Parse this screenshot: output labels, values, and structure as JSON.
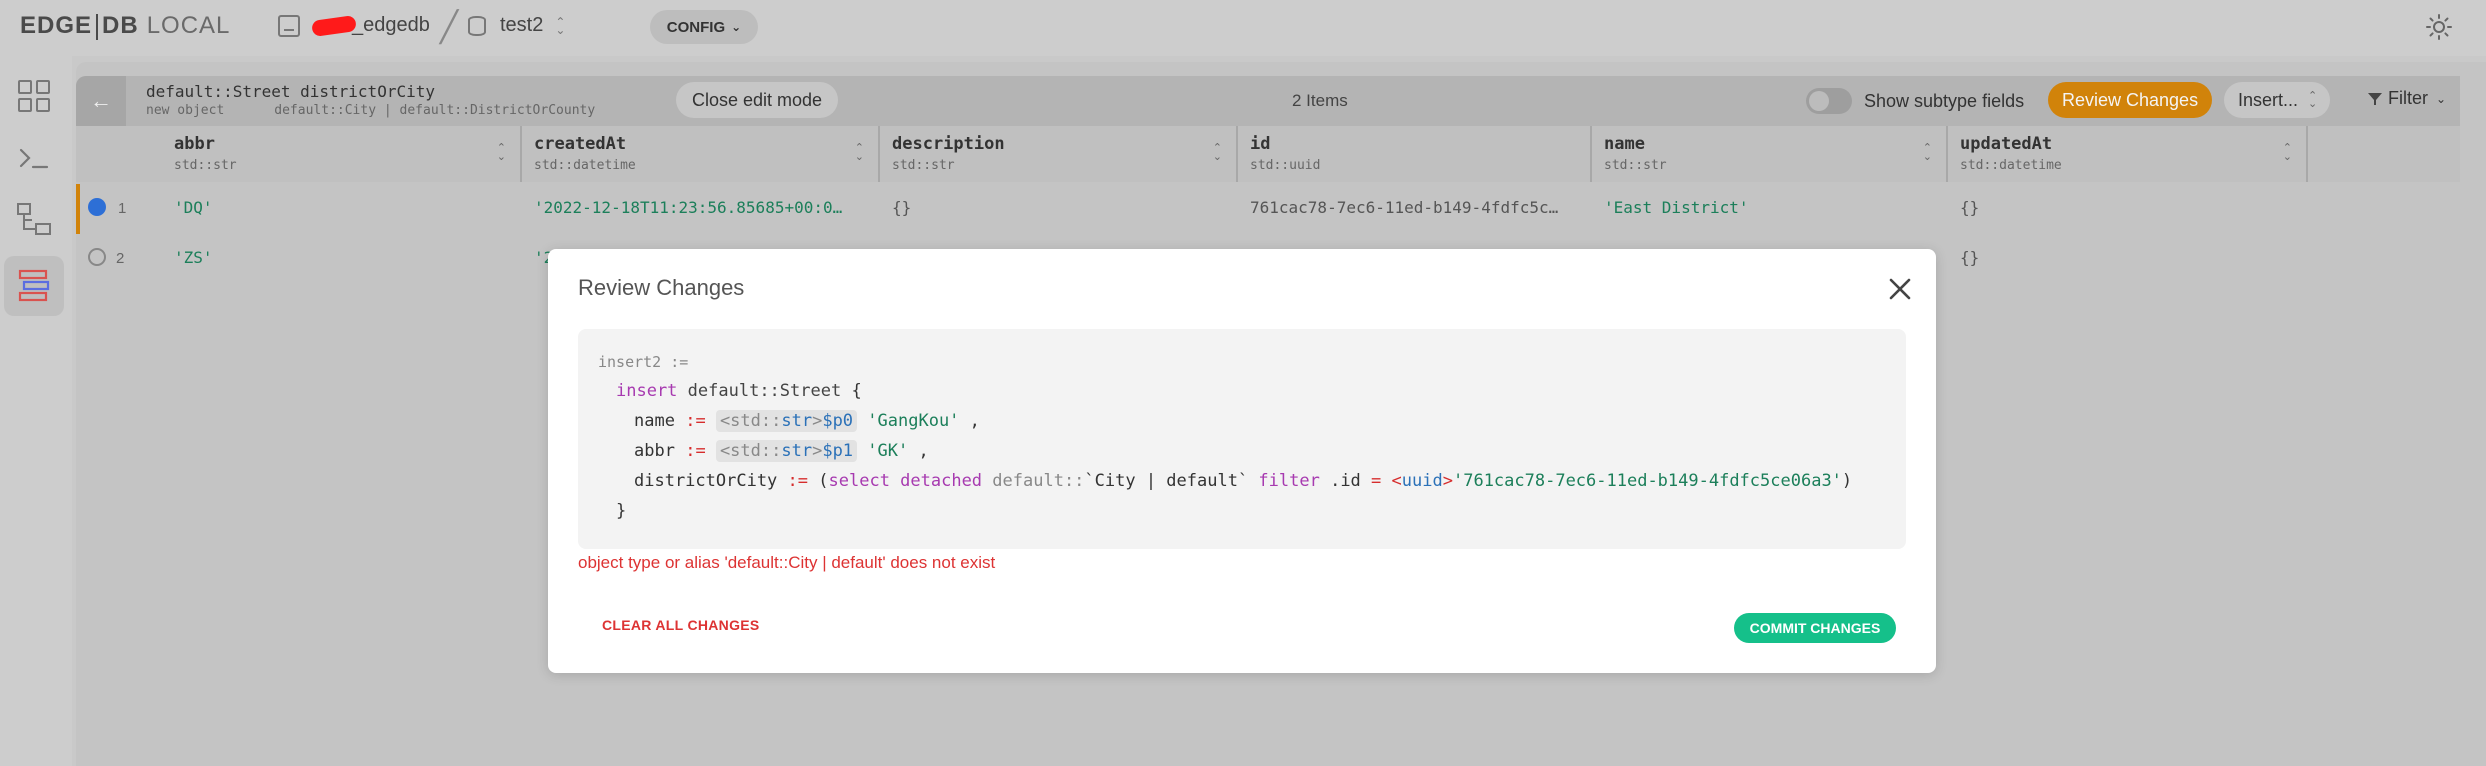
{
  "header": {
    "logo_left": "EDGE",
    "logo_right": "DB",
    "logo_suffix": "LOCAL",
    "instance_name": "_edgedb",
    "database": "test2",
    "config_label": "CONFIG"
  },
  "nav": {
    "items": [
      "dashboard",
      "repl",
      "schema",
      "data-editor"
    ]
  },
  "toolbar": {
    "object_path": "default::Street districtOrCity",
    "object_status": "new object",
    "object_types": "default::City | default::DistrictOrCounty",
    "close_edit_label": "Close edit mode",
    "items_count": "2 Items",
    "subtype_label": "Show subtype fields",
    "review_label": "Review Changes",
    "insert_label": "Insert...",
    "filter_label": "Filter"
  },
  "columns": [
    {
      "name": "abbr",
      "type": "std::str"
    },
    {
      "name": "createdAt",
      "type": "std::datetime"
    },
    {
      "name": "description",
      "type": "std::str"
    },
    {
      "name": "id",
      "type": "std::uuid"
    },
    {
      "name": "name",
      "type": "std::str"
    },
    {
      "name": "updatedAt",
      "type": "std::datetime"
    }
  ],
  "rows": [
    {
      "num": "1",
      "abbr": "'DQ'",
      "createdAt": "'2022-12-18T11:23:56.85685+00:0…",
      "description": "{}",
      "id": "761cac78-7ec6-11ed-b149-4fdfc5c…",
      "name": "'East District'",
      "updatedAt": "{}"
    },
    {
      "num": "2",
      "abbr": "'ZS'",
      "createdAt": "'2",
      "description": "",
      "id": "",
      "name": "",
      "updatedAt": "{}"
    }
  ],
  "modal": {
    "title": "Review Changes",
    "code": {
      "l1": "insert2 :=",
      "l2_kw": "insert",
      "l2_type": "default::Street",
      "l3_field": "name",
      "l3_param": "$p0",
      "l3_value": "'GangKou'",
      "l4_field": "abbr",
      "l4_param": "$p1",
      "l4_value": "'GK'",
      "l5_field": "districtOrCity",
      "l5_value": "'761cac78-7ec6-11ed-b149-4fdfc5ce06a3'"
    },
    "error": "object type or alias 'default::City | default' does not exist",
    "clear_label": "CLEAR ALL CHANGES",
    "commit_label": "COMMIT CHANGES"
  },
  "colors": {
    "review_button": "#d1830a",
    "commit_button": "#15c08a",
    "error_text": "#dd3333",
    "string_value": "#1c7f5a"
  }
}
